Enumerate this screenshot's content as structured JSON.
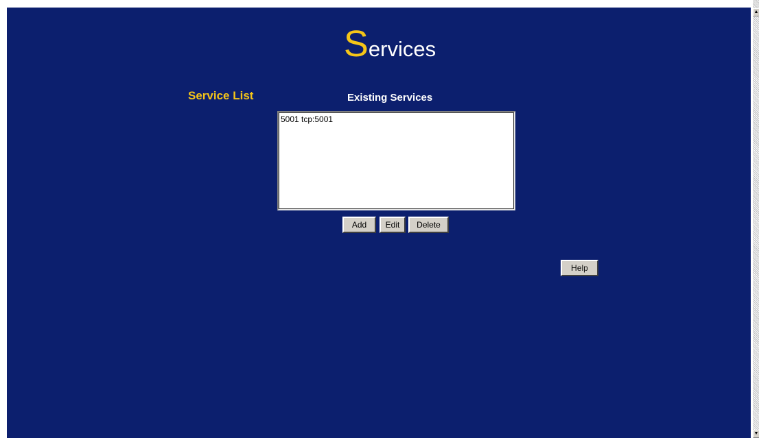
{
  "header": {
    "title_initial": "S",
    "title_rest": "ervices"
  },
  "section": {
    "label": "Service List"
  },
  "services": {
    "heading": "Existing Services",
    "items": [
      "5001 tcp:5001"
    ]
  },
  "actions": {
    "add_label": "Add",
    "edit_label": "Edit",
    "delete_label": "Delete",
    "help_label": "Help"
  },
  "colors": {
    "background": "#0c1f6e",
    "accent": "#f5c518",
    "text": "#ffffff"
  }
}
